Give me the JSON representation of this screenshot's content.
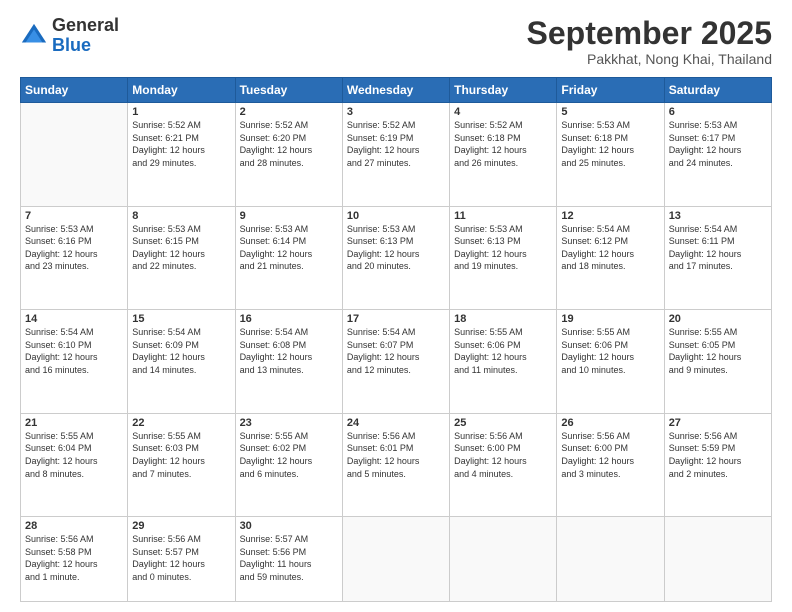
{
  "header": {
    "logo_general": "General",
    "logo_blue": "Blue",
    "month_title": "September 2025",
    "location": "Pakkhat, Nong Khai, Thailand"
  },
  "weekdays": [
    "Sunday",
    "Monday",
    "Tuesday",
    "Wednesday",
    "Thursday",
    "Friday",
    "Saturday"
  ],
  "weeks": [
    [
      {
        "day": "",
        "info": ""
      },
      {
        "day": "1",
        "info": "Sunrise: 5:52 AM\nSunset: 6:21 PM\nDaylight: 12 hours\nand 29 minutes."
      },
      {
        "day": "2",
        "info": "Sunrise: 5:52 AM\nSunset: 6:20 PM\nDaylight: 12 hours\nand 28 minutes."
      },
      {
        "day": "3",
        "info": "Sunrise: 5:52 AM\nSunset: 6:19 PM\nDaylight: 12 hours\nand 27 minutes."
      },
      {
        "day": "4",
        "info": "Sunrise: 5:52 AM\nSunset: 6:18 PM\nDaylight: 12 hours\nand 26 minutes."
      },
      {
        "day": "5",
        "info": "Sunrise: 5:53 AM\nSunset: 6:18 PM\nDaylight: 12 hours\nand 25 minutes."
      },
      {
        "day": "6",
        "info": "Sunrise: 5:53 AM\nSunset: 6:17 PM\nDaylight: 12 hours\nand 24 minutes."
      }
    ],
    [
      {
        "day": "7",
        "info": "Sunrise: 5:53 AM\nSunset: 6:16 PM\nDaylight: 12 hours\nand 23 minutes."
      },
      {
        "day": "8",
        "info": "Sunrise: 5:53 AM\nSunset: 6:15 PM\nDaylight: 12 hours\nand 22 minutes."
      },
      {
        "day": "9",
        "info": "Sunrise: 5:53 AM\nSunset: 6:14 PM\nDaylight: 12 hours\nand 21 minutes."
      },
      {
        "day": "10",
        "info": "Sunrise: 5:53 AM\nSunset: 6:13 PM\nDaylight: 12 hours\nand 20 minutes."
      },
      {
        "day": "11",
        "info": "Sunrise: 5:53 AM\nSunset: 6:13 PM\nDaylight: 12 hours\nand 19 minutes."
      },
      {
        "day": "12",
        "info": "Sunrise: 5:54 AM\nSunset: 6:12 PM\nDaylight: 12 hours\nand 18 minutes."
      },
      {
        "day": "13",
        "info": "Sunrise: 5:54 AM\nSunset: 6:11 PM\nDaylight: 12 hours\nand 17 minutes."
      }
    ],
    [
      {
        "day": "14",
        "info": "Sunrise: 5:54 AM\nSunset: 6:10 PM\nDaylight: 12 hours\nand 16 minutes."
      },
      {
        "day": "15",
        "info": "Sunrise: 5:54 AM\nSunset: 6:09 PM\nDaylight: 12 hours\nand 14 minutes."
      },
      {
        "day": "16",
        "info": "Sunrise: 5:54 AM\nSunset: 6:08 PM\nDaylight: 12 hours\nand 13 minutes."
      },
      {
        "day": "17",
        "info": "Sunrise: 5:54 AM\nSunset: 6:07 PM\nDaylight: 12 hours\nand 12 minutes."
      },
      {
        "day": "18",
        "info": "Sunrise: 5:55 AM\nSunset: 6:06 PM\nDaylight: 12 hours\nand 11 minutes."
      },
      {
        "day": "19",
        "info": "Sunrise: 5:55 AM\nSunset: 6:06 PM\nDaylight: 12 hours\nand 10 minutes."
      },
      {
        "day": "20",
        "info": "Sunrise: 5:55 AM\nSunset: 6:05 PM\nDaylight: 12 hours\nand 9 minutes."
      }
    ],
    [
      {
        "day": "21",
        "info": "Sunrise: 5:55 AM\nSunset: 6:04 PM\nDaylight: 12 hours\nand 8 minutes."
      },
      {
        "day": "22",
        "info": "Sunrise: 5:55 AM\nSunset: 6:03 PM\nDaylight: 12 hours\nand 7 minutes."
      },
      {
        "day": "23",
        "info": "Sunrise: 5:55 AM\nSunset: 6:02 PM\nDaylight: 12 hours\nand 6 minutes."
      },
      {
        "day": "24",
        "info": "Sunrise: 5:56 AM\nSunset: 6:01 PM\nDaylight: 12 hours\nand 5 minutes."
      },
      {
        "day": "25",
        "info": "Sunrise: 5:56 AM\nSunset: 6:00 PM\nDaylight: 12 hours\nand 4 minutes."
      },
      {
        "day": "26",
        "info": "Sunrise: 5:56 AM\nSunset: 6:00 PM\nDaylight: 12 hours\nand 3 minutes."
      },
      {
        "day": "27",
        "info": "Sunrise: 5:56 AM\nSunset: 5:59 PM\nDaylight: 12 hours\nand 2 minutes."
      }
    ],
    [
      {
        "day": "28",
        "info": "Sunrise: 5:56 AM\nSunset: 5:58 PM\nDaylight: 12 hours\nand 1 minute."
      },
      {
        "day": "29",
        "info": "Sunrise: 5:56 AM\nSunset: 5:57 PM\nDaylight: 12 hours\nand 0 minutes."
      },
      {
        "day": "30",
        "info": "Sunrise: 5:57 AM\nSunset: 5:56 PM\nDaylight: 11 hours\nand 59 minutes."
      },
      {
        "day": "",
        "info": ""
      },
      {
        "day": "",
        "info": ""
      },
      {
        "day": "",
        "info": ""
      },
      {
        "day": "",
        "info": ""
      }
    ]
  ]
}
